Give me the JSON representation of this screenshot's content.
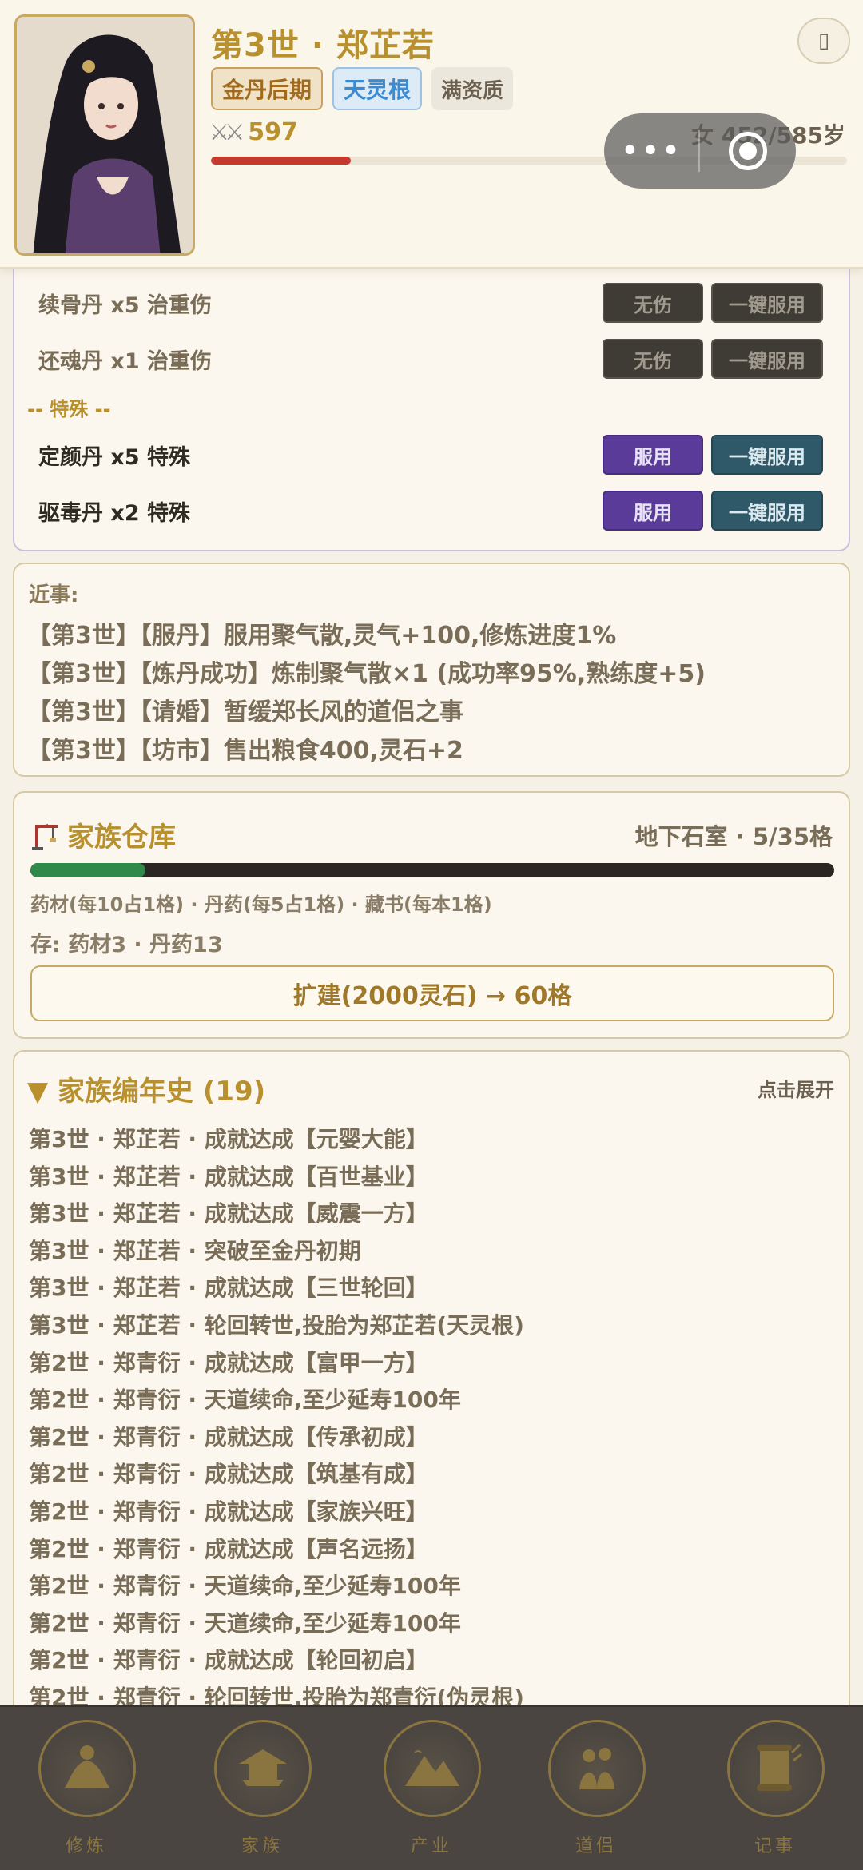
{
  "header": {
    "title": "第3世 · 郑芷若",
    "realm": "金丹后期",
    "root": "天灵根",
    "aptitude": "满资质",
    "combat_power": "597",
    "age_text": "女 452/585岁",
    "life_progress": 0.22
  },
  "pills": {
    "rows_top": [
      {
        "text": "续骨丹 x5  治重伤",
        "btn1": "无伤",
        "btn2": "一键服用"
      },
      {
        "text": "还魂丹 x1  治重伤",
        "btn1": "无伤",
        "btn2": "一键服用"
      }
    ],
    "special_label": "-- 特殊 --",
    "rows_special": [
      {
        "text": "定颜丹 x5  特殊",
        "btn1": "服用",
        "btn2": "一键服用"
      },
      {
        "text": "驱毒丹 x2  特殊",
        "btn1": "服用",
        "btn2": "一键服用"
      }
    ]
  },
  "recent": {
    "title": "近事:",
    "lines": [
      "【第3世】【服丹】服用聚气散,灵气+100,修炼进度1%",
      "【第3世】【炼丹成功】炼制聚气散×1 (成功率95%,熟练度+5)",
      "【第3世】【请婚】暂缓郑长风的道侣之事",
      "【第3世】【坊市】售出粮食400,灵石+2"
    ]
  },
  "warehouse": {
    "title": "家族仓库",
    "location": "地下石室 · 5/35格",
    "fill_ratio": 0.143,
    "rule": "药材(每10占1格) · 丹药(每5占1格) · 藏书(每本1格)",
    "stock": "存: 药材3 · 丹药13",
    "expand_label": "扩建(2000灵石) → 60格"
  },
  "chronicle": {
    "title": "▼ 家族编年史 (19)",
    "expand_label": "点击展开",
    "entries": [
      "第3世 · 郑芷若 · 成就达成【元婴大能】",
      "第3世 · 郑芷若 · 成就达成【百世基业】",
      "第3世 · 郑芷若 · 成就达成【威震一方】",
      "第3世 · 郑芷若 · 突破至金丹初期",
      "第3世 · 郑芷若 · 成就达成【三世轮回】",
      "第3世 · 郑芷若 · 轮回转世,投胎为郑芷若(天灵根)",
      "第2世 · 郑青衍 · 成就达成【富甲一方】",
      "第2世 · 郑青衍 · 天道续命,至少延寿100年",
      "第2世 · 郑青衍 · 成就达成【传承初成】",
      "第2世 · 郑青衍 · 成就达成【筑基有成】",
      "第2世 · 郑青衍 · 成就达成【家族兴旺】",
      "第2世 · 郑青衍 · 成就达成【声名远扬】",
      "第2世 · 郑青衍 · 天道续命,至少延寿100年",
      "第2世 · 郑青衍 · 天道续命,至少延寿100年",
      "第2世 · 郑青衍 · 成就达成【轮回初启】",
      "第2世 · 郑青衍 · 轮回转世,投胎为郑青衍(伪灵根)"
    ]
  },
  "nav": {
    "items": [
      {
        "label": "修炼",
        "icon": "meditation-icon"
      },
      {
        "label": "家族",
        "icon": "pavilion-icon"
      },
      {
        "label": "产业",
        "icon": "mountain-icon"
      },
      {
        "label": "道侣",
        "icon": "couple-icon"
      },
      {
        "label": "记事",
        "icon": "scroll-icon"
      }
    ]
  },
  "colors": {
    "gold": "#b8902e",
    "life_bar": "#c43a2e",
    "storage_bar": "#2f8a4a",
    "purple_button": "#5b3b9a",
    "teal_button": "#2f5968"
  }
}
